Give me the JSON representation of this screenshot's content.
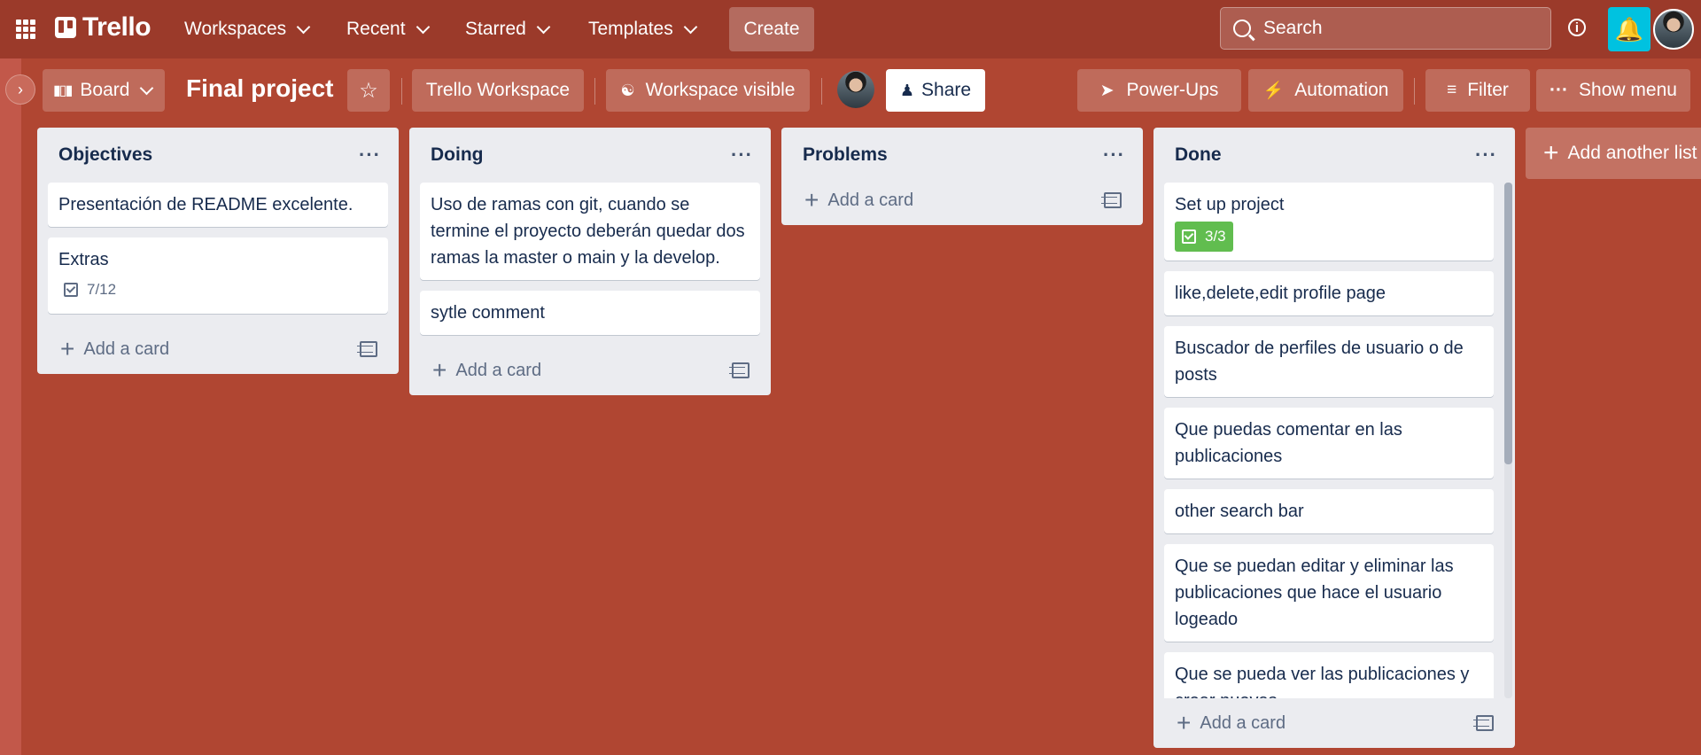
{
  "nav": {
    "logo": "Trello",
    "workspaces": "Workspaces",
    "recent": "Recent",
    "starred": "Starred",
    "templates": "Templates",
    "create": "Create",
    "search_placeholder": "Search"
  },
  "board": {
    "view": "Board",
    "title": "Final project",
    "workspace": "Trello Workspace",
    "visibility": "Workspace visible",
    "share": "Share",
    "powerups": "Power-Ups",
    "automation": "Automation",
    "filter": "Filter",
    "show_menu": "Show menu"
  },
  "lists": [
    {
      "title": "Objectives",
      "cards": [
        {
          "text": "Presentación de README excelente."
        },
        {
          "text": "Extras",
          "checklist": "7/12"
        }
      ],
      "add_card": "Add a card"
    },
    {
      "title": "Doing",
      "cards": [
        {
          "text": "Uso de ramas con git, cuando se termine el proyecto deberán quedar dos ramas la master o main y la develop."
        },
        {
          "text": "sytle comment"
        }
      ],
      "add_card": "Add a card"
    },
    {
      "title": "Problems",
      "cards": [],
      "add_card": "Add a card"
    },
    {
      "title": "Done",
      "cards": [
        {
          "text": "Set up project",
          "checklist": "3/3"
        },
        {
          "text": "like,delete,edit profile page"
        },
        {
          "text": "Buscador de perfiles de usuario o de posts"
        },
        {
          "text": "Que puedas comentar en las publicaciones"
        },
        {
          "text": "other search bar"
        },
        {
          "text": "Que se puedan editar y eliminar las publicaciones que hace el usuario logeado"
        },
        {
          "text": "Que se pueda ver las publicaciones y crear nuevas."
        }
      ],
      "add_card": "Add a card"
    }
  ],
  "add_list": "Add another list",
  "colors": {
    "board_bg": "#b04632",
    "nav_bg": "#9b3a2a",
    "notification": "#00c2e0",
    "checklist_complete": "#61bd4f"
  }
}
